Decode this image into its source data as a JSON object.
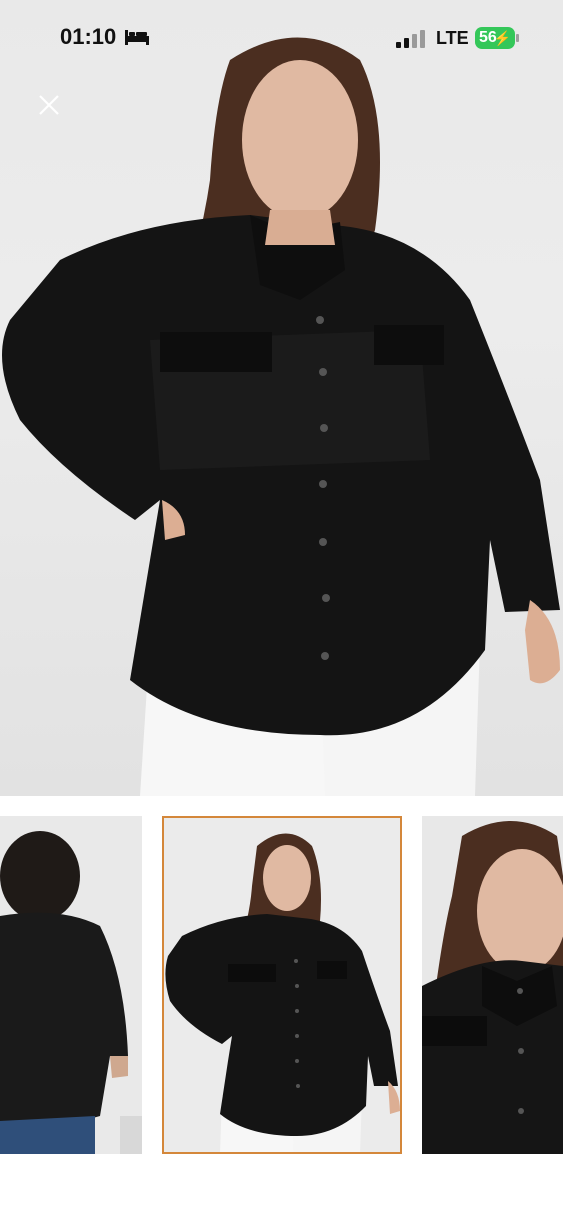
{
  "status_bar": {
    "time": "01:10",
    "network": "LTE",
    "battery": "56",
    "icons": [
      "bed-icon",
      "signal-icon",
      "battery-icon"
    ]
  },
  "viewer": {
    "close_icon": "close-icon",
    "selected_thumbnail": 2,
    "thumbnails": [
      "back-view",
      "front-view",
      "close-up-view"
    ]
  },
  "colors": {
    "accent": "#d4873a",
    "battery": "#34c759",
    "shirt": "#141414"
  }
}
